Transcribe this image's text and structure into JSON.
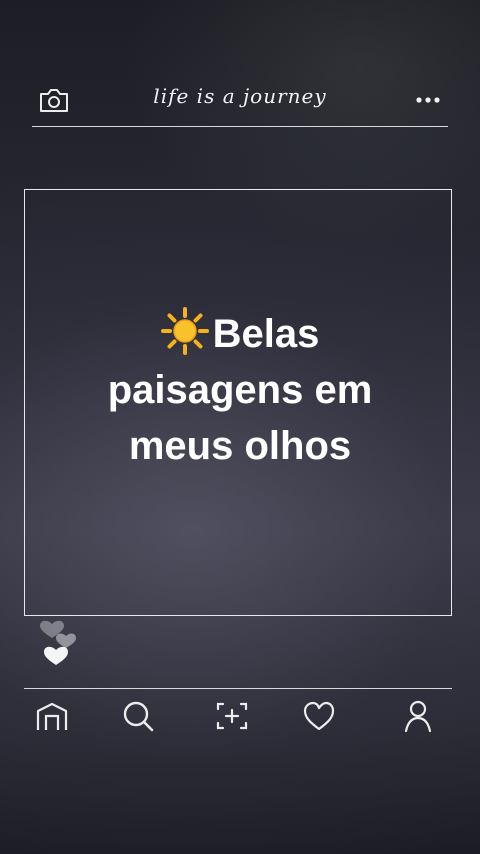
{
  "header": {
    "title": "life is a journey",
    "camera_icon": "camera-icon",
    "more_icon": "more-horizontal-icon"
  },
  "post": {
    "emoji_icon": "sun-icon",
    "headline_line1": "Belas",
    "headline_line2": "paisagens em",
    "headline_line3": "meus olhos"
  },
  "reactions": {
    "icon": "heart-icon"
  },
  "bottom_nav": {
    "items": [
      {
        "name": "home",
        "icon": "home-icon"
      },
      {
        "name": "search",
        "icon": "search-icon"
      },
      {
        "name": "add",
        "icon": "add-post-icon"
      },
      {
        "name": "likes",
        "icon": "heart-icon"
      },
      {
        "name": "profile",
        "icon": "profile-icon"
      }
    ]
  },
  "colors": {
    "line": "#d8d8dc",
    "text": "#ffffff",
    "sun": "#f6b21a"
  }
}
